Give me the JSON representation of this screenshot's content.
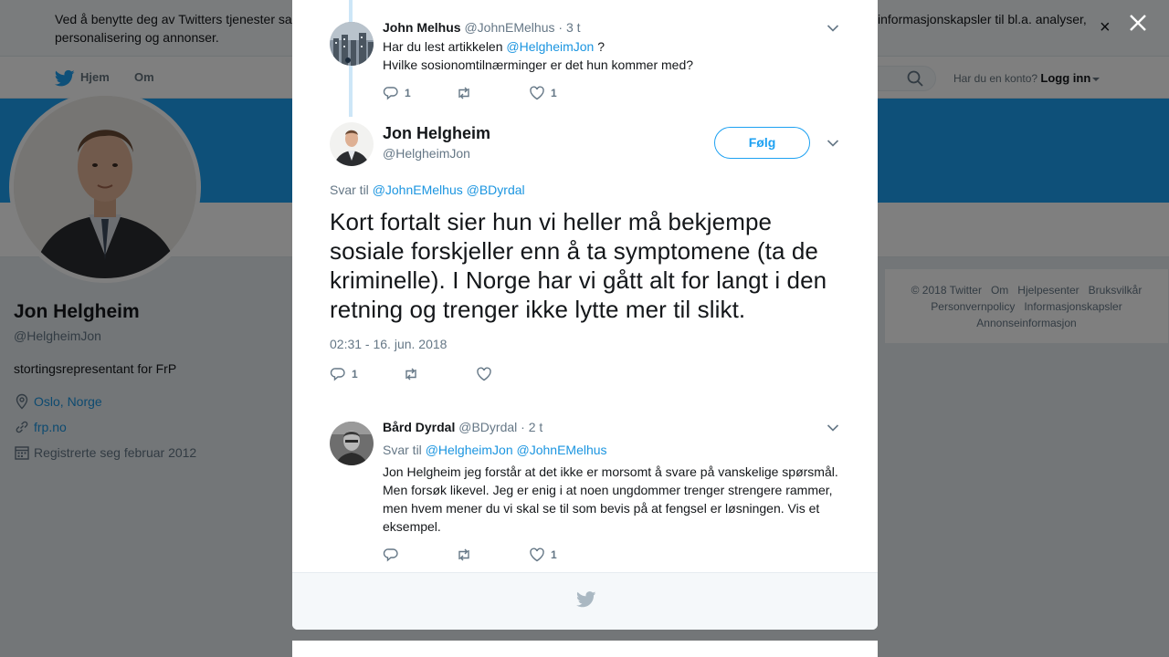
{
  "cookie_banner": {
    "text_left": "Ved å benytte deg av Twitters tjenester sa",
    "text_left_line2": "personalisering og annonser.",
    "text_right": "informasjonskapsler til bl.a. analyser,",
    "close_glyph": "×"
  },
  "topnav": {
    "home": "Hjem",
    "about": "Om",
    "account_prompt": "Har du en konto?",
    "login": "Logg inn"
  },
  "profile": {
    "name": "Jon Helgheim",
    "handle": "@HelgheimJon",
    "bio": "stortingsrepresentant for FrP",
    "location": "Oslo, Norge",
    "website": "frp.no",
    "joined": "Registrerte seg februar 2012"
  },
  "footer": {
    "links_row1": [
      "© 2018 Twitter",
      "Om",
      "Hjelpesenter",
      "Bruksvilkår"
    ],
    "links_row2": [
      "Personvernpolicy",
      "Informasjonskapsler"
    ],
    "links_row3": [
      "Annonseinformasjon"
    ]
  },
  "modal": {
    "parent_tweet": {
      "fullname": "John Melhus",
      "username": "@JohnEMelhus",
      "time": "· 3 t",
      "text_line1_prefix": "Har du lest artikkelen ",
      "text_line1_mention": "@HelgheimJon",
      "text_line1_suffix": " ?",
      "text_line2": "Hvilke sosionomtilnærminger er det hun  kommer med?",
      "reply_count": "1",
      "retweet_count": "",
      "like_count": "1"
    },
    "main_tweet": {
      "fullname": "Jon Helgheim",
      "username": "@HelgheimJon",
      "follow_label": "Følg",
      "reply_to_label": "Svar til",
      "reply_to_mentions": "@JohnEMelhus @BDyrdal",
      "text": "Kort fortalt sier hun vi heller må bekjempe sosiale forskjeller enn å ta symptomene (ta de kriminelle). I Norge har vi gått alt for langt i den retning og trenger ikke lytte mer til slikt.",
      "timestamp": "02:31 - 16. jun. 2018",
      "reply_count": "1",
      "retweet_count": "",
      "like_count": ""
    },
    "reply_tweet": {
      "fullname": "Bård Dyrdal",
      "username": "@BDyrdal",
      "time": "· 2 t",
      "reply_to_label": "Svar til",
      "reply_to_mentions": "@HelgheimJon @JohnEMelhus",
      "text": "Jon Helgheim jeg forstår at det ikke er morsomt å svare på vanskelige spørsmål. Men forsøk likevel. Jeg er enig i at noen ungdommer trenger strengere rammer, men hvem mener du vi skal se til som bevis på at fengsel er løsningen. Vis et eksempel.",
      "reply_count": "",
      "retweet_count": "",
      "like_count": "1"
    }
  },
  "colors": {
    "twitter_blue": "#1da1f2",
    "link_blue": "#1b95e0",
    "text_primary": "#14171a",
    "text_secondary": "#657786"
  }
}
